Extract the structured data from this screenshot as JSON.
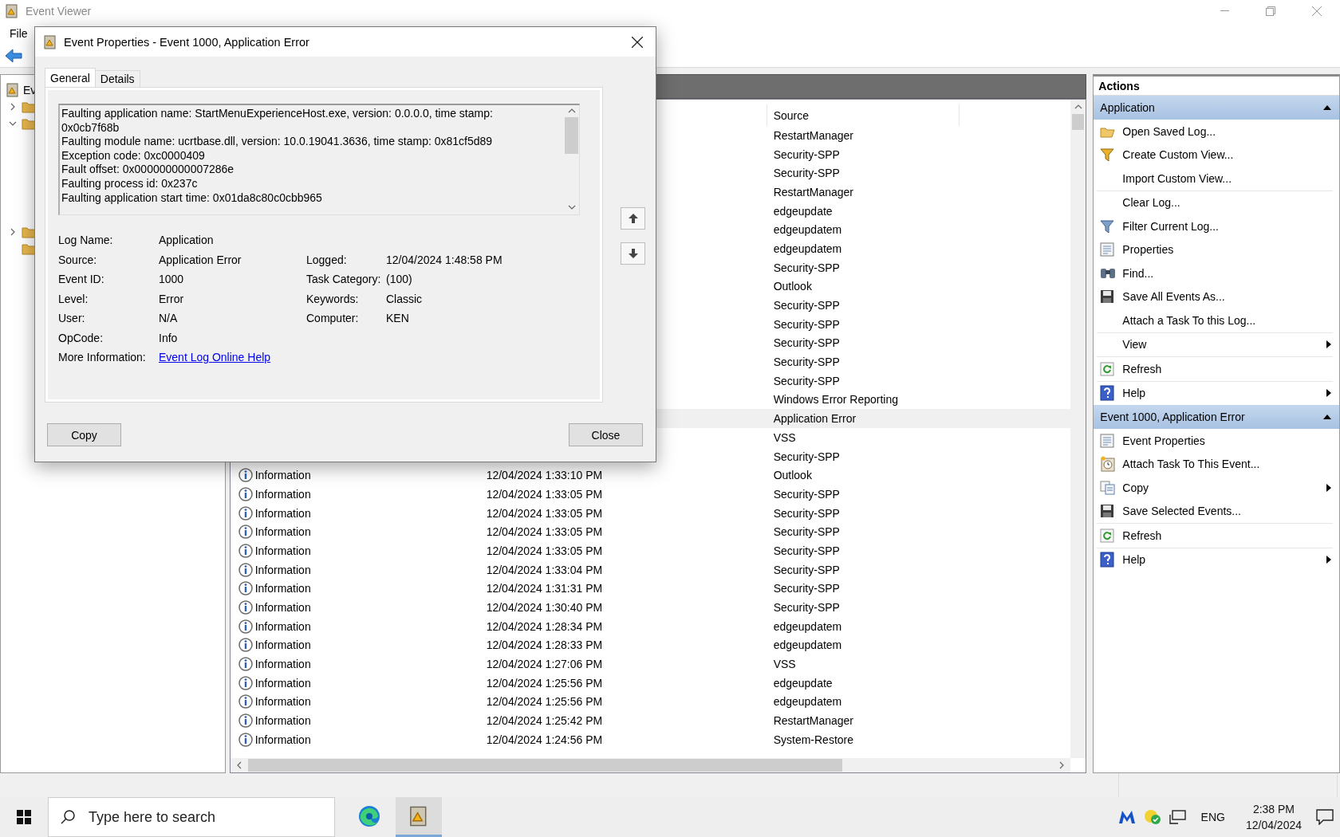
{
  "window": {
    "title": "Event Viewer"
  },
  "menu": [
    "File"
  ],
  "tree": {
    "root": {
      "label": "Ev"
    },
    "items": [
      {
        "kind": "node",
        "expanded": false
      },
      {
        "kind": "node",
        "expanded": true
      },
      {
        "kind": "node",
        "expanded": false
      },
      {
        "kind": "leaf"
      }
    ]
  },
  "events": {
    "source_column": "Source",
    "rows": [
      {
        "source": "RestartManager",
        "selected": false
      },
      {
        "source": "Security-SPP",
        "selected": false
      },
      {
        "source": "Security-SPP",
        "selected": false
      },
      {
        "source": "RestartManager",
        "selected": false
      },
      {
        "source": "edgeupdate",
        "selected": false
      },
      {
        "source": "edgeupdatem",
        "selected": false
      },
      {
        "source": "edgeupdatem",
        "selected": false
      },
      {
        "source": "Security-SPP",
        "selected": false
      },
      {
        "source": "Outlook",
        "selected": false
      },
      {
        "source": "Security-SPP",
        "selected": false
      },
      {
        "source": "Security-SPP",
        "selected": false
      },
      {
        "source": "Security-SPP",
        "selected": false
      },
      {
        "source": "Security-SPP",
        "selected": false
      },
      {
        "source": "Security-SPP",
        "selected": false
      },
      {
        "source": "Windows Error Reporting",
        "selected": false
      },
      {
        "source": "Application Error",
        "selected": true
      },
      {
        "source": "VSS",
        "selected": false
      },
      {
        "source": "Security-SPP",
        "selected": false
      },
      {
        "level": "Information",
        "date": "12/04/2024 1:33:10 PM",
        "source": "Outlook",
        "selected": false
      },
      {
        "level": "Information",
        "date": "12/04/2024 1:33:05 PM",
        "source": "Security-SPP",
        "selected": false
      },
      {
        "level": "Information",
        "date": "12/04/2024 1:33:05 PM",
        "source": "Security-SPP",
        "selected": false
      },
      {
        "level": "Information",
        "date": "12/04/2024 1:33:05 PM",
        "source": "Security-SPP",
        "selected": false
      },
      {
        "level": "Information",
        "date": "12/04/2024 1:33:05 PM",
        "source": "Security-SPP",
        "selected": false
      },
      {
        "level": "Information",
        "date": "12/04/2024 1:33:04 PM",
        "source": "Security-SPP",
        "selected": false
      },
      {
        "level": "Information",
        "date": "12/04/2024 1:31:31 PM",
        "source": "Security-SPP",
        "selected": false
      },
      {
        "level": "Information",
        "date": "12/04/2024 1:30:40 PM",
        "source": "Security-SPP",
        "selected": false
      },
      {
        "level": "Information",
        "date": "12/04/2024 1:28:34 PM",
        "source": "edgeupdatem",
        "selected": false
      },
      {
        "level": "Information",
        "date": "12/04/2024 1:28:33 PM",
        "source": "edgeupdatem",
        "selected": false
      },
      {
        "level": "Information",
        "date": "12/04/2024 1:27:06 PM",
        "source": "VSS",
        "selected": false
      },
      {
        "level": "Information",
        "date": "12/04/2024 1:25:56 PM",
        "source": "edgeupdate",
        "selected": false
      },
      {
        "level": "Information",
        "date": "12/04/2024 1:25:56 PM",
        "source": "edgeupdatem",
        "selected": false
      },
      {
        "level": "Information",
        "date": "12/04/2024 1:25:42 PM",
        "source": "RestartManager",
        "selected": false
      },
      {
        "level": "Information",
        "date": "12/04/2024 1:24:56 PM",
        "source": "System-Restore",
        "selected": false
      }
    ]
  },
  "actions": {
    "title": "Actions",
    "sections": [
      {
        "title": "Application",
        "expanded": true,
        "groups": [
          [
            {
              "label": "Open Saved Log...",
              "submenu": false
            },
            {
              "label": "Create Custom View...",
              "submenu": false
            },
            {
              "label": "Import Custom View...",
              "submenu": false
            }
          ],
          [
            {
              "label": "Clear Log...",
              "submenu": false
            },
            {
              "label": "Filter Current Log...",
              "submenu": false
            },
            {
              "label": "Properties",
              "submenu": false
            },
            {
              "label": "Find...",
              "submenu": false
            },
            {
              "label": "Save All Events As...",
              "submenu": false
            },
            {
              "label": "Attach a Task To this Log...",
              "submenu": false
            }
          ],
          [
            {
              "label": "View",
              "submenu": true
            }
          ],
          [
            {
              "label": "Refresh",
              "submenu": false
            }
          ],
          [
            {
              "label": "Help",
              "submenu": true
            }
          ]
        ]
      },
      {
        "title": "Event 1000, Application Error",
        "expanded": true,
        "groups": [
          [
            {
              "label": "Event Properties",
              "submenu": false
            },
            {
              "label": "Attach Task To This Event...",
              "submenu": false
            },
            {
              "label": "Copy",
              "submenu": true
            },
            {
              "label": "Save Selected Events...",
              "submenu": false
            }
          ],
          [
            {
              "label": "Refresh",
              "submenu": false
            }
          ],
          [
            {
              "label": "Help",
              "submenu": true
            }
          ]
        ]
      }
    ]
  },
  "dialog": {
    "title": "Event Properties - Event 1000, Application Error",
    "tabs": [
      {
        "label": "General",
        "selected": true
      },
      {
        "label": "Details",
        "selected": false
      }
    ],
    "description_lines": [
      "Faulting application name: StartMenuExperienceHost.exe, version: 0.0.0.0, time stamp:",
      "0x0cb7f68b",
      "Faulting module name: ucrtbase.dll, version: 10.0.19041.3636, time stamp: 0x81cf5d89",
      "Exception code: 0xc0000409",
      "Fault offset: 0x000000000007286e",
      "Faulting process id: 0x237c",
      "Faulting application start time: 0x01da8c80c0cbb965"
    ],
    "left_fields": [
      {
        "label": "Log Name:",
        "value": "Application",
        "kind": "text"
      },
      {
        "label": "Source:",
        "value": "Application Error",
        "kind": "text"
      },
      {
        "label": "Event ID:",
        "value": "1000",
        "kind": "text"
      },
      {
        "label": "Level:",
        "value": "Error",
        "kind": "text"
      },
      {
        "label": "User:",
        "value": "N/A",
        "kind": "text"
      },
      {
        "label": "OpCode:",
        "value": "Info",
        "kind": "text"
      },
      {
        "label": "More Information:",
        "value": "Event Log Online Help",
        "kind": "link"
      }
    ],
    "right_fields": [
      {
        "label": "Logged:",
        "value": "12/04/2024 1:48:58 PM"
      },
      {
        "label": "Task Category:",
        "value": "(100)"
      },
      {
        "label": "Keywords:",
        "value": "Classic"
      },
      {
        "label": "Computer:",
        "value": "KEN"
      }
    ],
    "buttons": [
      {
        "label": "Copy"
      },
      {
        "label": "Close"
      }
    ]
  },
  "taskbar": {
    "search": {
      "placeholder": "Type here to search"
    },
    "apps": [
      {
        "kind": "browser",
        "active": false
      },
      {
        "kind": "event-viewer",
        "active": true
      }
    ],
    "language": "ENG",
    "time": "2:38 PM",
    "date": "12/04/2024"
  }
}
